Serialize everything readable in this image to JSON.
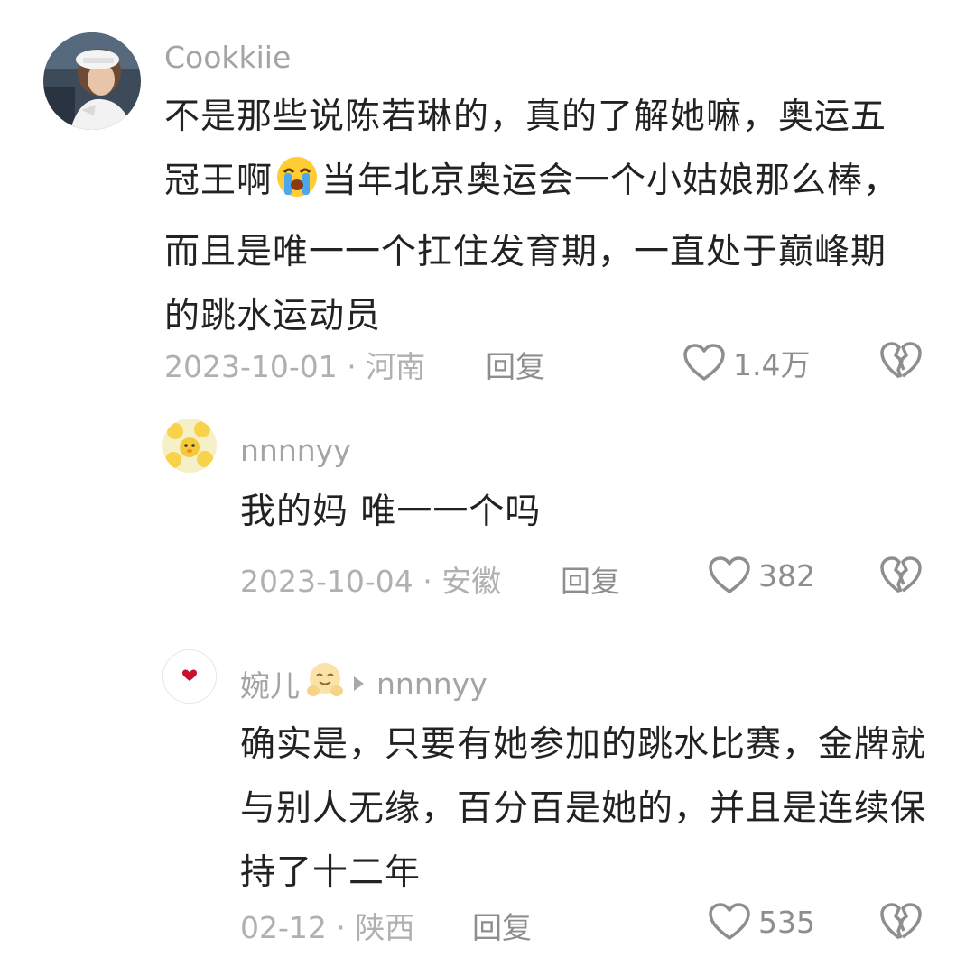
{
  "colors": {
    "text": "#222222",
    "muted": "#a4a4a4",
    "action": "#8e8e8e",
    "heart_red": "#c8102e"
  },
  "comments": [
    {
      "author": "Cookkiie",
      "avatar_icon": "user-photo-avatar",
      "text_before_emoji": "不是那些说陈若琳的，真的了解她嘛，奥运五冠王啊",
      "emoji": "loudly-crying-face-emoji",
      "text_after_emoji": "当年北京奥运会一个小姑娘那么棒，而且是唯一一个扛住发育期，一直处于巅峰期的跳水运动员",
      "meta": "2023-10-01 · 河南",
      "reply": "回复",
      "likes": "1.4万"
    },
    {
      "author": "nnnnyy",
      "avatar_icon": "yellow-duck-pattern-avatar",
      "text": "我的妈 唯一一个吗",
      "meta": "2023-10-04 · 安徽",
      "reply": "回复",
      "likes": "382"
    },
    {
      "author": "婉儿",
      "author_emoji": "hugging-face-emoji",
      "reply_to": "nnnnyy",
      "avatar_icon": "small-red-heart-avatar",
      "text": "确实是，只要有她参加的跳水比赛，金牌就与别人无缘，百分百是她的，并且是连续保持了十二年",
      "meta": "02-12 · 陕西",
      "reply": "回复",
      "likes": "535"
    }
  ]
}
